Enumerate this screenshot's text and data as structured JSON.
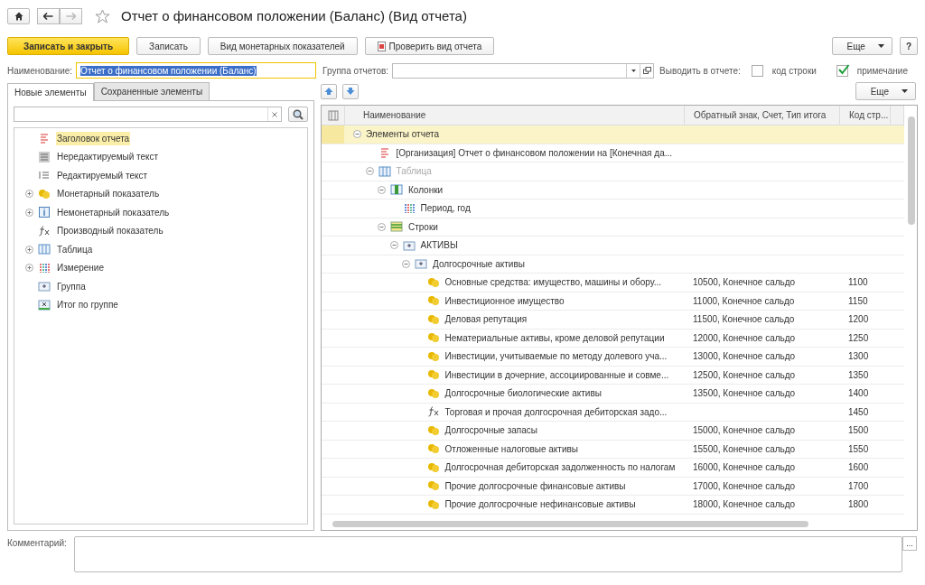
{
  "window": {
    "title": "Отчет о финансовом положении (Баланс) (Вид отчета)",
    "favorite": false
  },
  "toolbar": {
    "buttons": [
      {
        "label": "Записать и закрыть",
        "kind": "primary"
      },
      {
        "label": "Записать",
        "kind": "plain"
      },
      {
        "label": "Вид монетарных показателей",
        "kind": "plain"
      },
      {
        "label": "Проверить вид отчета",
        "kind": "report"
      }
    ],
    "more": "Еще",
    "help": "?"
  },
  "name_field": {
    "label": "Наименование:",
    "value": "Отчет о финансовом положении (Баланс)"
  },
  "group_field": {
    "label": "Группа отчетов:"
  },
  "output": {
    "label": "Выводить в отчете:",
    "options": [
      {
        "label": "код строки",
        "checked": false
      },
      {
        "label": "примечание",
        "checked": true
      }
    ]
  },
  "left_tabs": [
    {
      "label": "Новые элементы",
      "selected": true
    },
    {
      "label": "Сохраненные элементы",
      "selected": false
    }
  ],
  "left_items": [
    {
      "label": "Заголовок отчета",
      "kind": "heading",
      "selected": true
    },
    {
      "label": "Нередактируемый текст",
      "kind": "text",
      "selected": false
    },
    {
      "label": "Редактируемый текст",
      "kind": "edit",
      "selected": false
    },
    {
      "label": "Монетарный показатель",
      "kind": "money",
      "selected": false,
      "expanded": false
    },
    {
      "label": "Немонетарный показатель",
      "kind": "info",
      "selected": false,
      "expanded": false
    },
    {
      "label": "Производный показатель",
      "kind": "formula",
      "selected": false
    },
    {
      "label": "Таблица",
      "kind": "table",
      "selected": false,
      "expanded": false
    },
    {
      "label": "Измерение",
      "kind": "dimension",
      "selected": false,
      "expanded": false
    },
    {
      "label": "Группа",
      "kind": "group",
      "selected": false
    },
    {
      "label": "Итог по группе",
      "kind": "total",
      "selected": false
    }
  ],
  "tree": {
    "more": "Еще",
    "columns": [
      "Наименование",
      "Обратный знак, Счет, Тип итога",
      "Код стр..."
    ],
    "rows": [
      {
        "name": "Элементы отчета",
        "selected": true,
        "disabled": false,
        "expanded": true,
        "children": [
          {
            "name": "[Организация] Отчет о финансовом положении на [Конечная да...",
            "kind": "heading",
            "selected": false,
            "disabled": false
          },
          {
            "name": "Таблица",
            "kind": "table",
            "selected": false,
            "disabled": true,
            "expanded": true,
            "children": [
              {
                "name": "Колонки",
                "kind": "columns",
                "selected": false,
                "disabled": false,
                "expanded": true,
                "children": [
                  {
                    "name": "Период, год",
                    "kind": "dimension",
                    "selected": false,
                    "disabled": false
                  }
                ]
              },
              {
                "name": "Строки",
                "kind": "rows",
                "selected": false,
                "disabled": false,
                "expanded": true,
                "children": [
                  {
                    "name": "АКТИВЫ",
                    "kind": "group",
                    "selected": false,
                    "disabled": false,
                    "expanded": true,
                    "children": [
                      {
                        "name": "Долгосрочные активы",
                        "kind": "group",
                        "selected": false,
                        "disabled": false,
                        "expanded": true,
                        "children": [
                          {
                            "name": "Основные средства: имущество, машины и обору...",
                            "kind": "money",
                            "selected": false,
                            "disabled": false,
                            "account": "10500, Конечное сальдо",
                            "code": "1100"
                          },
                          {
                            "name": "Инвестиционное имущество",
                            "kind": "money",
                            "selected": false,
                            "disabled": false,
                            "account": "11000, Конечное сальдо",
                            "code": "1150"
                          },
                          {
                            "name": "Деловая репутация",
                            "kind": "money",
                            "selected": false,
                            "disabled": false,
                            "account": "11500, Конечное сальдо",
                            "code": "1200"
                          },
                          {
                            "name": "Нематериальные активы, кроме деловой репутации",
                            "kind": "money",
                            "selected": false,
                            "disabled": false,
                            "account": "12000, Конечное сальдо",
                            "code": "1250"
                          },
                          {
                            "name": "Инвестиции, учитываемые по методу долевого уча...",
                            "kind": "money",
                            "selected": false,
                            "disabled": false,
                            "account": "13000, Конечное сальдо",
                            "code": "1300"
                          },
                          {
                            "name": "Инвестиции в дочерние, ассоциированные и совме...",
                            "kind": "money",
                            "selected": false,
                            "disabled": false,
                            "account": "12500, Конечное сальдо",
                            "code": "1350"
                          },
                          {
                            "name": "Долгосрочные биологические активы",
                            "kind": "money",
                            "selected": false,
                            "disabled": false,
                            "account": "13500, Конечное сальдо",
                            "code": "1400"
                          },
                          {
                            "name": "Торговая и прочая долгосрочная дебиторская задо...",
                            "kind": "formula",
                            "selected": false,
                            "disabled": false,
                            "code": "1450"
                          },
                          {
                            "name": "Долгосрочные запасы",
                            "kind": "money",
                            "selected": false,
                            "disabled": false,
                            "account": "15000, Конечное сальдо",
                            "code": "1500"
                          },
                          {
                            "name": "Отложенные налоговые активы",
                            "kind": "money",
                            "selected": false,
                            "disabled": false,
                            "account": "15500, Конечное сальдо",
                            "code": "1550"
                          },
                          {
                            "name": "Долгосрочная дебиторская задолженность по налогам",
                            "kind": "money",
                            "selected": false,
                            "disabled": false,
                            "account": "16000, Конечное сальдо",
                            "code": "1600"
                          },
                          {
                            "name": "Прочие долгосрочные финансовые активы",
                            "kind": "money",
                            "selected": false,
                            "disabled": false,
                            "account": "17000, Конечное сальдо",
                            "code": "1700"
                          },
                          {
                            "name": "Прочие долгосрочные нефинансовые активы",
                            "kind": "money",
                            "selected": false,
                            "disabled": false,
                            "account": "18000, Конечное сальдо",
                            "code": "1800"
                          }
                        ]
                      }
                    ]
                  }
                ]
              }
            ]
          }
        ]
      }
    ]
  },
  "comment": {
    "label": "Комментарий:",
    "button": "..."
  }
}
